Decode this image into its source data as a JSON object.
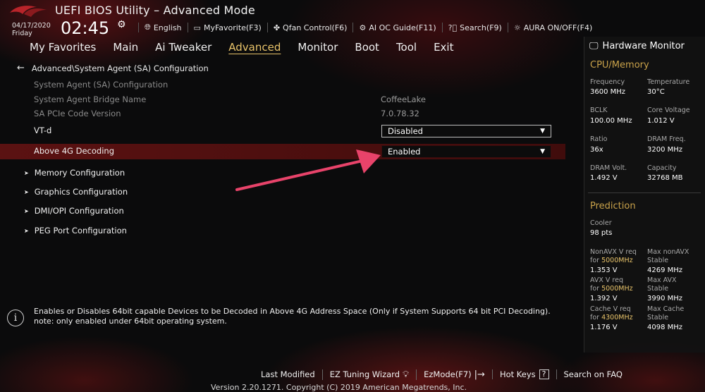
{
  "header": {
    "title": "UEFI BIOS Utility – Advanced Mode",
    "date": "04/17/2020",
    "day": "Friday",
    "time": "02:45",
    "toolbar": [
      {
        "icon": "globe-icon",
        "label": "English"
      },
      {
        "icon": "favorite-icon",
        "label": "MyFavorite(F3)"
      },
      {
        "icon": "fan-icon",
        "label": "Qfan Control(F6)"
      },
      {
        "icon": "ai-oc-icon",
        "label": "AI OC Guide(F11)"
      },
      {
        "icon": "search-icon",
        "label": "Search(F9)"
      },
      {
        "icon": "aura-icon",
        "label": "AURA ON/OFF(F4)"
      }
    ]
  },
  "menu": {
    "items": [
      "My Favorites",
      "Main",
      "Ai Tweaker",
      "Advanced",
      "Monitor",
      "Boot",
      "Tool",
      "Exit"
    ],
    "active": "Advanced"
  },
  "breadcrumb": "Advanced\\System Agent (SA) Configuration",
  "rows": {
    "sa_config": "System Agent (SA) Configuration",
    "bridge_label": "System Agent Bridge Name",
    "bridge_value": "CoffeeLake",
    "pcie_label": "SA PCIe Code Version",
    "pcie_value": "7.0.78.32",
    "vtd_label": "VT-d",
    "vtd_value": "Disabled",
    "above4g_label": "Above 4G Decoding",
    "above4g_value": "Enabled"
  },
  "submenus": [
    "Memory Configuration",
    "Graphics Configuration",
    "DMI/OPI Configuration",
    "PEG Port Configuration"
  ],
  "info": {
    "line1": "Enables or Disables 64bit capable Devices to be Decoded in Above 4G Address Space (Only if System Supports 64 bit PCI Decoding).",
    "line2": "note: only enabled under 64bit operating system."
  },
  "hardware_monitor": {
    "title": "Hardware Monitor",
    "cpu_memory_title": "CPU/Memory",
    "frequency_label": "Frequency",
    "frequency_value": "3600 MHz",
    "temperature_label": "Temperature",
    "temperature_value": "30°C",
    "bclk_label": "BCLK",
    "bclk_value": "100.00 MHz",
    "core_voltage_label": "Core Voltage",
    "core_voltage_value": "1.012 V",
    "ratio_label": "Ratio",
    "ratio_value": "36x",
    "dram_freq_label": "DRAM Freq.",
    "dram_freq_value": "3200 MHz",
    "dram_volt_label": "DRAM Volt.",
    "dram_volt_value": "1.492 V",
    "capacity_label": "Capacity",
    "capacity_value": "32768 MB",
    "prediction_title": "Prediction",
    "cooler_label": "Cooler",
    "cooler_value": "98 pts",
    "nonavx_label": "NonAVX V req",
    "nonavx_for": "for",
    "nonavx_freq": "5000MHz",
    "nonavx_value": "1.353 V",
    "max_nonavx_label": "Max nonAVX",
    "max_nonavx_sub": "Stable",
    "max_nonavx_value": "4269 MHz",
    "avx_label": "AVX V req",
    "avx_for": "for",
    "avx_freq": "5000MHz",
    "avx_value": "1.392 V",
    "max_avx_label": "Max AVX",
    "max_avx_sub": "Stable",
    "max_avx_value": "3990 MHz",
    "cache_label": "Cache V req",
    "cache_for": "for",
    "cache_freq": "4300MHz",
    "cache_value": "1.176 V",
    "max_cache_label": "Max Cache",
    "max_cache_sub": "Stable",
    "max_cache_value": "4098 MHz"
  },
  "bottom_bar": {
    "last_modified": "Last Modified",
    "ez_tuning": "EZ Tuning Wizard",
    "ezmode": "EzMode(F7)",
    "hot_keys": "Hot Keys",
    "hot_keys_key": "?",
    "search_faq": "Search on FAQ",
    "version": "Version 2.20.1271. Copyright (C) 2019 American Megatrends, Inc."
  },
  "colors": {
    "accent_gold": "#c9a24a",
    "active_tab": "#e8c36a",
    "highlight_row": "#5f1212",
    "annotation_arrow": "#e8436a"
  }
}
